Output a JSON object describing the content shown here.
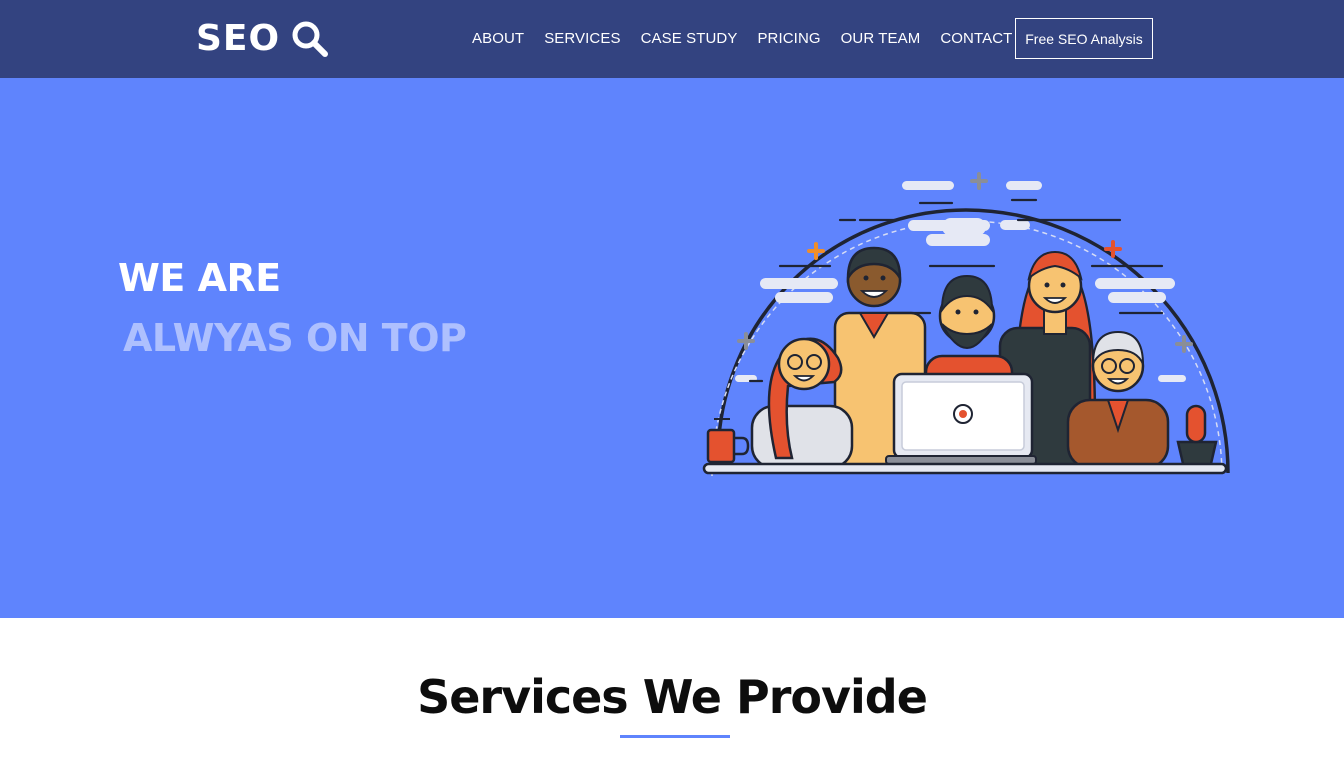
{
  "header": {
    "logo_text": "SEO",
    "logo_icon": "magnifier-icon",
    "nav": [
      {
        "label": "ABOUT"
      },
      {
        "label": "SERVICES"
      },
      {
        "label": "CASE STUDY"
      },
      {
        "label": "PRICING"
      },
      {
        "label": "OUR TEAM"
      },
      {
        "label": "CONTACT"
      }
    ],
    "cta_label": "Free SEO Analysis"
  },
  "hero": {
    "line1": "WE ARE",
    "line2": "ALWYAS ON TOP",
    "illustration": "team-illustration"
  },
  "services": {
    "title": "Services We Provide"
  },
  "colors": {
    "navbar": "#334380",
    "hero_bg": "#5f84fd",
    "hero_accent_text": "#aec0fe",
    "underline": "#5f84fd"
  }
}
